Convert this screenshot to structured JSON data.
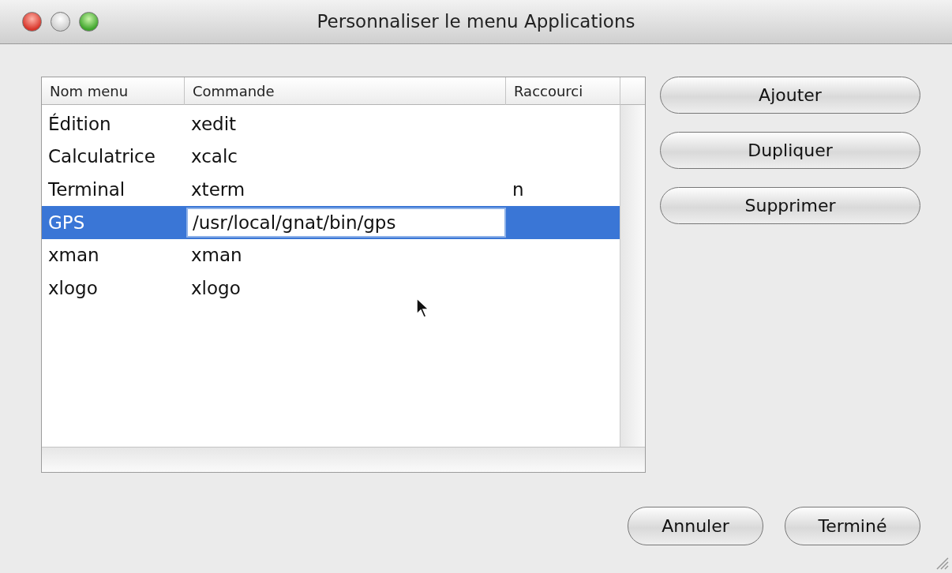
{
  "window": {
    "title": "Personnaliser le menu Applications"
  },
  "table": {
    "columns": [
      "Nom menu",
      "Commande",
      "Raccourci"
    ],
    "rows": [
      {
        "cells": [
          "Édition",
          "xedit",
          ""
        ],
        "selected": false,
        "editing": false
      },
      {
        "cells": [
          "Calculatrice",
          "xcalc",
          ""
        ],
        "selected": false,
        "editing": false
      },
      {
        "cells": [
          "Terminal",
          "xterm",
          "n"
        ],
        "selected": false,
        "editing": false
      },
      {
        "cells": [
          "GPS",
          "/usr/local/gnat/bin/gps",
          ""
        ],
        "selected": true,
        "editing": true
      },
      {
        "cells": [
          "xman",
          "xman",
          ""
        ],
        "selected": false,
        "editing": false
      },
      {
        "cells": [
          "xlogo",
          "xlogo",
          ""
        ],
        "selected": false,
        "editing": false
      }
    ]
  },
  "side_buttons": [
    "Ajouter",
    "Dupliquer",
    "Supprimer"
  ],
  "footer_buttons": [
    "Annuler",
    "Terminé"
  ]
}
